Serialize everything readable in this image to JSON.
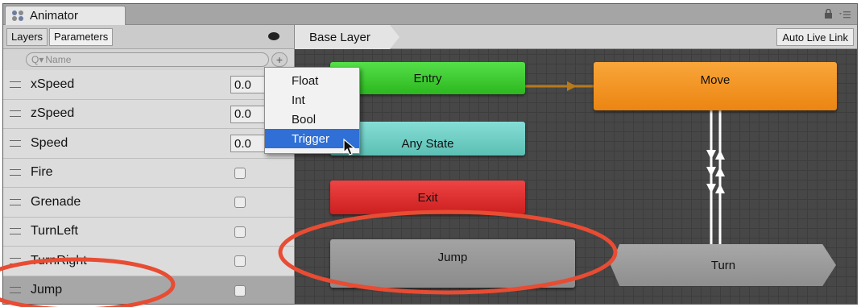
{
  "window": {
    "title": "Animator",
    "icon": "animator-icon",
    "lock_icon": "lock-icon",
    "menu_icon": "menu-icon"
  },
  "left_panel": {
    "tabs": [
      {
        "label": "Layers",
        "active": false
      },
      {
        "label": "Parameters",
        "active": true
      }
    ],
    "eye_icon": "eye-icon",
    "search": {
      "placeholder": "Name",
      "prefix": "Q▾"
    },
    "add_button": "+",
    "parameters": [
      {
        "name": "xSpeed",
        "type": "float",
        "value": "0.0"
      },
      {
        "name": "zSpeed",
        "type": "float",
        "value": "0.0"
      },
      {
        "name": "Speed",
        "type": "float",
        "value": "0.0"
      },
      {
        "name": "Fire",
        "type": "bool",
        "checked": false
      },
      {
        "name": "Grenade",
        "type": "bool",
        "checked": false
      },
      {
        "name": "TurnLeft",
        "type": "bool",
        "checked": false
      },
      {
        "name": "TurnRight",
        "type": "bool",
        "checked": false
      },
      {
        "name": "Jump",
        "type": "bool",
        "checked": false,
        "selected": true
      }
    ]
  },
  "add_menu": {
    "items": [
      "Float",
      "Int",
      "Bool",
      "Trigger"
    ],
    "highlighted": "Trigger"
  },
  "graph": {
    "breadcrumb": "Base Layer",
    "auto_live_link": "Auto Live Link",
    "states": {
      "entry": "Entry",
      "any_state": "Any State",
      "exit": "Exit",
      "jump": "Jump",
      "move": "Move",
      "turn": "Turn"
    }
  },
  "colors": {
    "entry": "#3ccf2e",
    "any_state": "#6fcfc4",
    "exit": "#de2f2f",
    "move": "#f29624",
    "state_default": "#999999",
    "transition_entry": "#b87a1a",
    "transition": "#ffffff",
    "highlight_ring": "#e84c33",
    "menu_highlight": "#2f6fd6"
  }
}
